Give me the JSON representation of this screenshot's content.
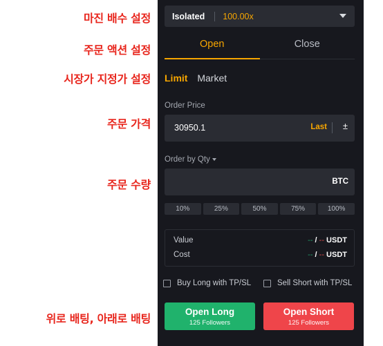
{
  "annotations": {
    "margin": "마진 배수 설정",
    "order_action": "주문 액션 설정",
    "order_type": "시장가 지정가 설정",
    "price": "주문 가격",
    "quantity": "주문 수량",
    "buttons": "위로 배팅, 아래로 배팅"
  },
  "margin": {
    "mode": "Isolated",
    "leverage": "100.00x"
  },
  "tabs": [
    {
      "label": "Open"
    },
    {
      "label": "Close"
    }
  ],
  "order_types": [
    {
      "label": "Limit"
    },
    {
      "label": "Market"
    }
  ],
  "order_price": {
    "label": "Order Price",
    "value": "30950.1",
    "last": "Last",
    "toggle_icon": "±"
  },
  "quantity": {
    "label": "Order by Qty",
    "unit": "BTC"
  },
  "percentages": [
    "10%",
    "25%",
    "50%",
    "75%",
    "100%"
  ],
  "summary": {
    "value": {
      "label": "Value",
      "long": "--",
      "sep": " / ",
      "short": "--",
      "unit": " USDT"
    },
    "cost": {
      "label": "Cost",
      "long": "--",
      "sep": " / ",
      "short": "--",
      "unit": " USDT"
    }
  },
  "checkboxes": {
    "long": "Buy Long with TP/SL",
    "short": "Sell Short with TP/SL"
  },
  "buttons": {
    "long": {
      "title": "Open Long",
      "sub": "125 Followers"
    },
    "short": {
      "title": "Open Short",
      "sub": "125 Followers"
    }
  },
  "colors": {
    "accent": "#f7a600",
    "long": "#20b26c",
    "short": "#ef454a",
    "panel": "#17181e",
    "annotation": "#e8261d"
  }
}
